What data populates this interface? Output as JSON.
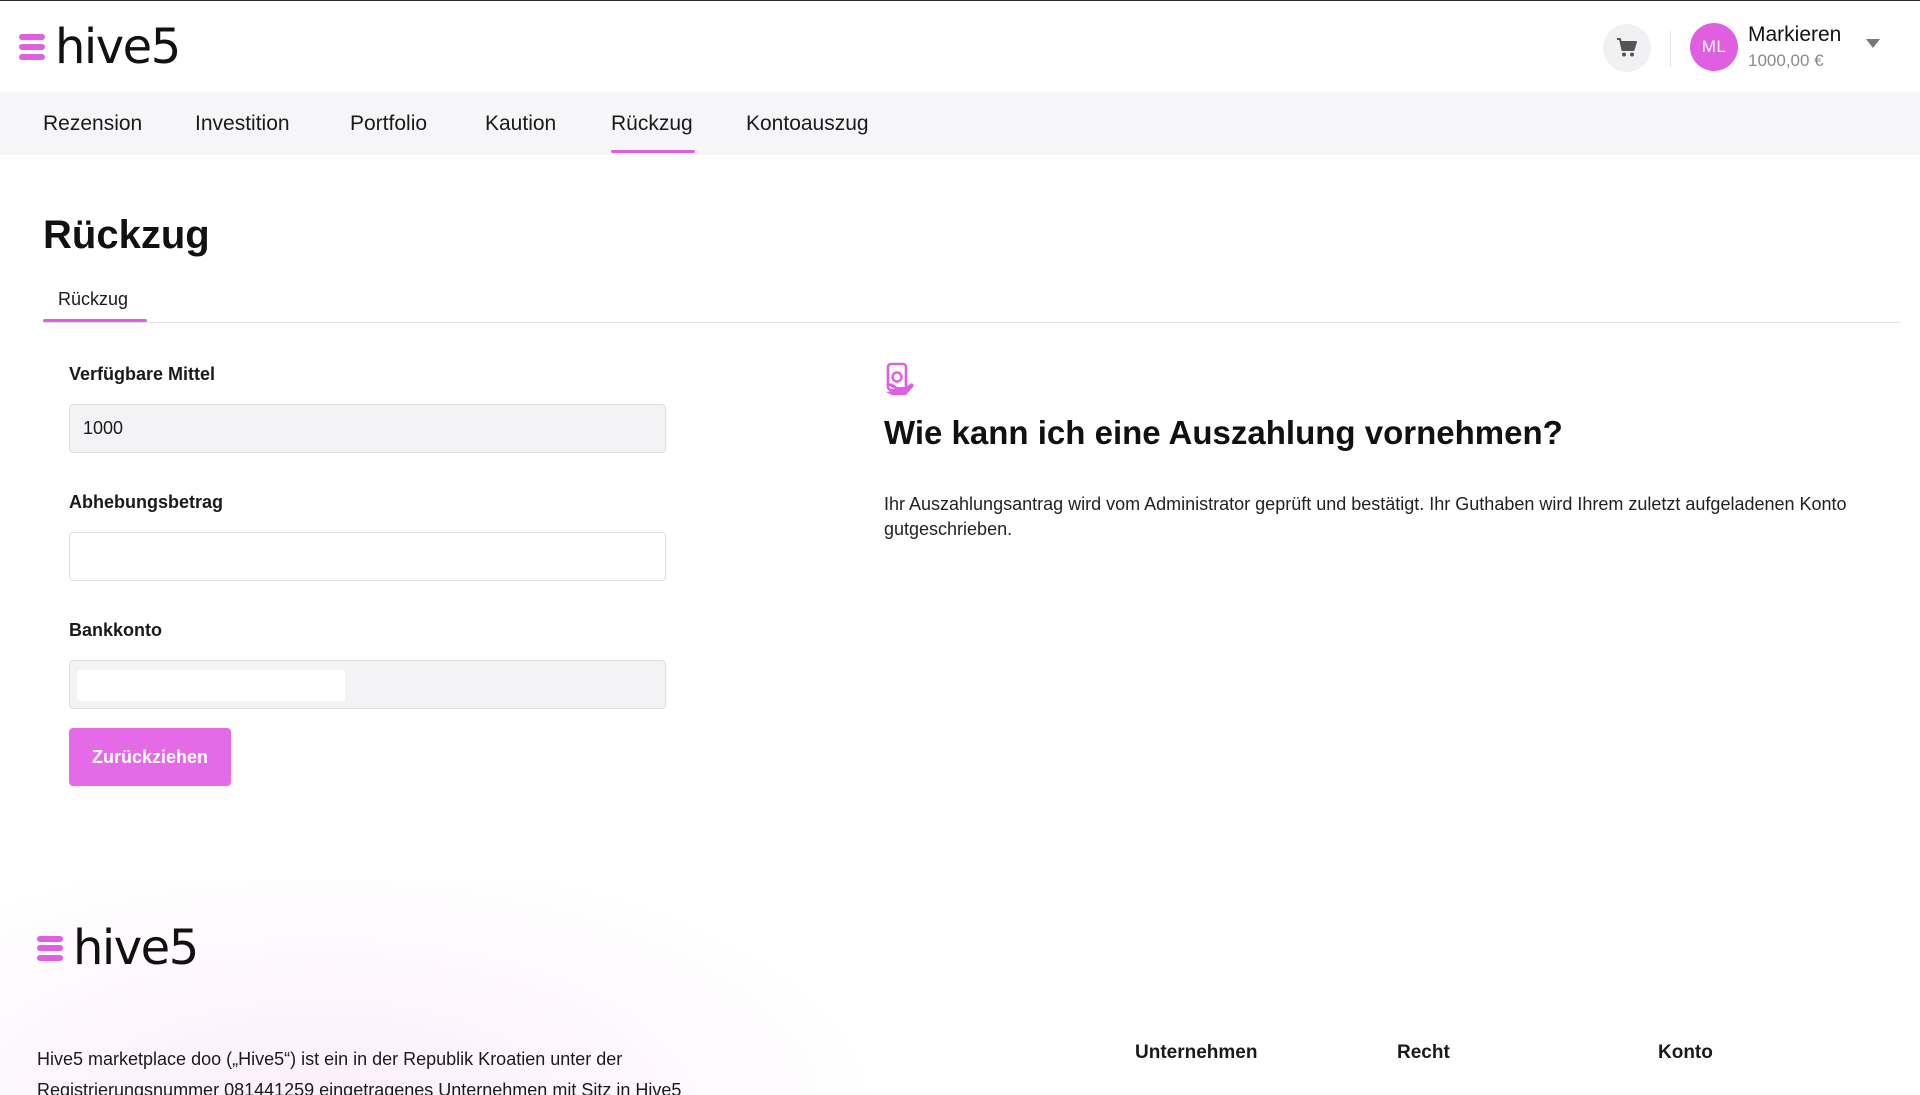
{
  "brand": {
    "name": "hive5",
    "accent": "#e05ee0"
  },
  "header": {
    "cart_icon": "cart-icon",
    "user": {
      "initials": "ML",
      "name": "Markieren",
      "balance": "1000,00 €"
    }
  },
  "nav": {
    "items": [
      {
        "label": "Rezension"
      },
      {
        "label": "Investition"
      },
      {
        "label": "Portfolio"
      },
      {
        "label": "Kaution"
      },
      {
        "label": "Rückzug",
        "active": true
      },
      {
        "label": "Kontoauszug"
      }
    ]
  },
  "page": {
    "title": "Rückzug",
    "subtab": "Rückzug"
  },
  "form": {
    "available_label": "Verfügbare Mittel",
    "available_value": "1000",
    "amount_label": "Abhebungsbetrag",
    "amount_value": "",
    "bank_label": "Bankkonto",
    "submit_label": "Zurückziehen"
  },
  "info": {
    "icon": "money-hand-icon",
    "title": "Wie kann ich eine Auszahlung vornehmen?",
    "text": "Ihr Auszahlungsantrag wird vom Administrator geprüft und bestätigt. Ihr Guthaben wird Ihrem zuletzt aufgeladenen Konto gutgeschrieben."
  },
  "footer": {
    "description": "Hive5 marketplace doo („Hive5“) ist ein in der Republik Kroatien unter der Registrierungsnummer 081441259 eingetragenes Unternehmen mit Sitz in Hive5",
    "columns": [
      {
        "heading": "Unternehmen"
      },
      {
        "heading": "Recht"
      },
      {
        "heading": "Konto"
      }
    ]
  }
}
